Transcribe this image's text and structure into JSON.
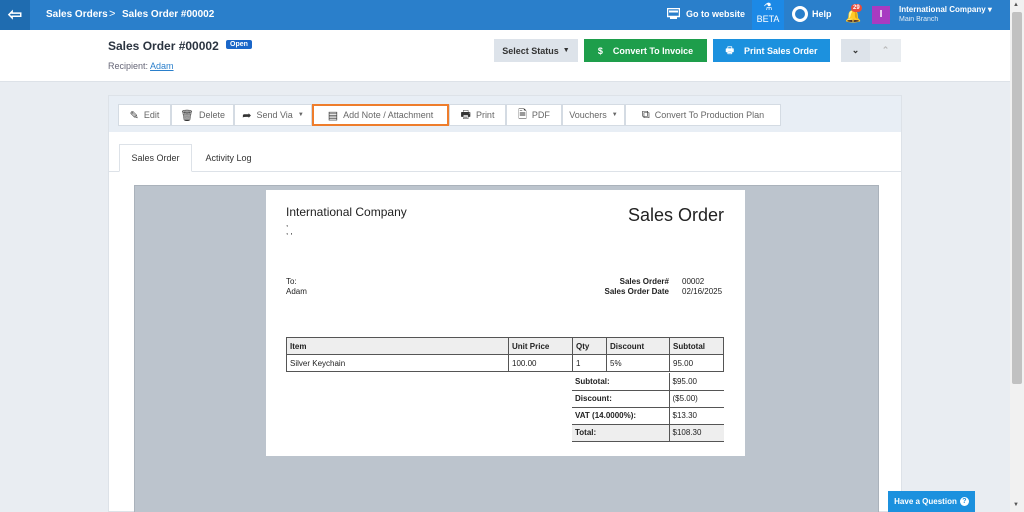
{
  "nav": {
    "crumb1": "Sales Orders",
    "crumb_sep": ">",
    "crumb2": "Sales Order #00002",
    "goto_label": "Go to website",
    "beta_label": "BETA",
    "help_label": "Help",
    "notif_count": "29",
    "avatar_letter": "I",
    "company_name": "International Company",
    "branch_name": "Main Branch"
  },
  "header": {
    "title": "Sales Order #00002",
    "status": "Open",
    "recipient_label": "Recipient:",
    "recipient_name": "Adam",
    "select_status": "Select Status",
    "convert_invoice": "Convert To Invoice",
    "print_order": "Print Sales Order"
  },
  "toolbar": {
    "edit": "Edit",
    "delete": "Delete",
    "send_via": "Send Via",
    "add_note": "Add Note / Attachment",
    "print": "Print",
    "pdf": "PDF",
    "vouchers": "Vouchers",
    "convert_production": "Convert To Production Plan"
  },
  "tabs": {
    "sales_order": "Sales Order",
    "activity_log": "Activity Log"
  },
  "document": {
    "company": "International Company",
    "company_addr1": ",",
    "company_addr2": ", ,",
    "heading": "Sales Order",
    "to_label": "To:",
    "to_name": "Adam",
    "order_no_label": "Sales Order#",
    "order_no": "00002",
    "order_date_label": "Sales Order Date",
    "order_date": "02/16/2025",
    "columns": [
      "Item",
      "Unit Price",
      "Qty",
      "Discount",
      "Subtotal"
    ],
    "rows": [
      {
        "item": "Silver Keychain",
        "unit_price": "100.00",
        "qty": "1",
        "discount": "5%",
        "subtotal": "95.00"
      }
    ],
    "totals": [
      {
        "label": "Subtotal:",
        "value": "$95.00"
      },
      {
        "label": "Discount:",
        "value": "($5.00)"
      },
      {
        "label": "VAT (14.0000%):",
        "value": "$13.30"
      },
      {
        "label": "Total:",
        "value": "$108.30"
      }
    ]
  },
  "have_question": "Have a Question",
  "colors": {
    "topbar": "#2a7fcb",
    "convert_btn": "#1e9e4b",
    "print_btn": "#1c91de",
    "status_badge": "#1a66c8",
    "active_outline": "#ee7d2c"
  }
}
